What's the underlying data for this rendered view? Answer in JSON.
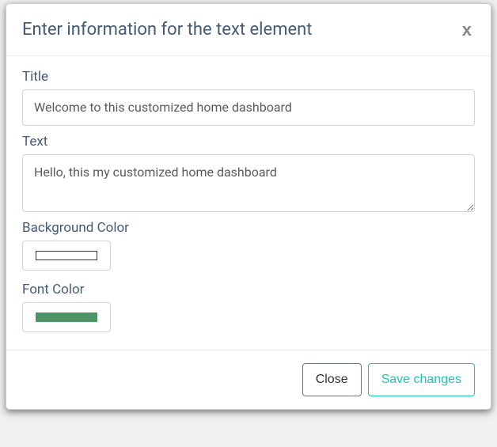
{
  "modal": {
    "title": "Enter information for the text element",
    "close_symbol": "x"
  },
  "form": {
    "title_label": "Title",
    "title_value": "Welcome to this customized home dashboard",
    "text_label": "Text",
    "text_value": "Hello, this my customized home dashboard",
    "bg_color_label": "Background Color",
    "bg_color_value": "#ffffff",
    "font_color_label": "Font Color",
    "font_color_value": "#4d9466"
  },
  "footer": {
    "close_label": "Close",
    "save_label": "Save changes"
  }
}
